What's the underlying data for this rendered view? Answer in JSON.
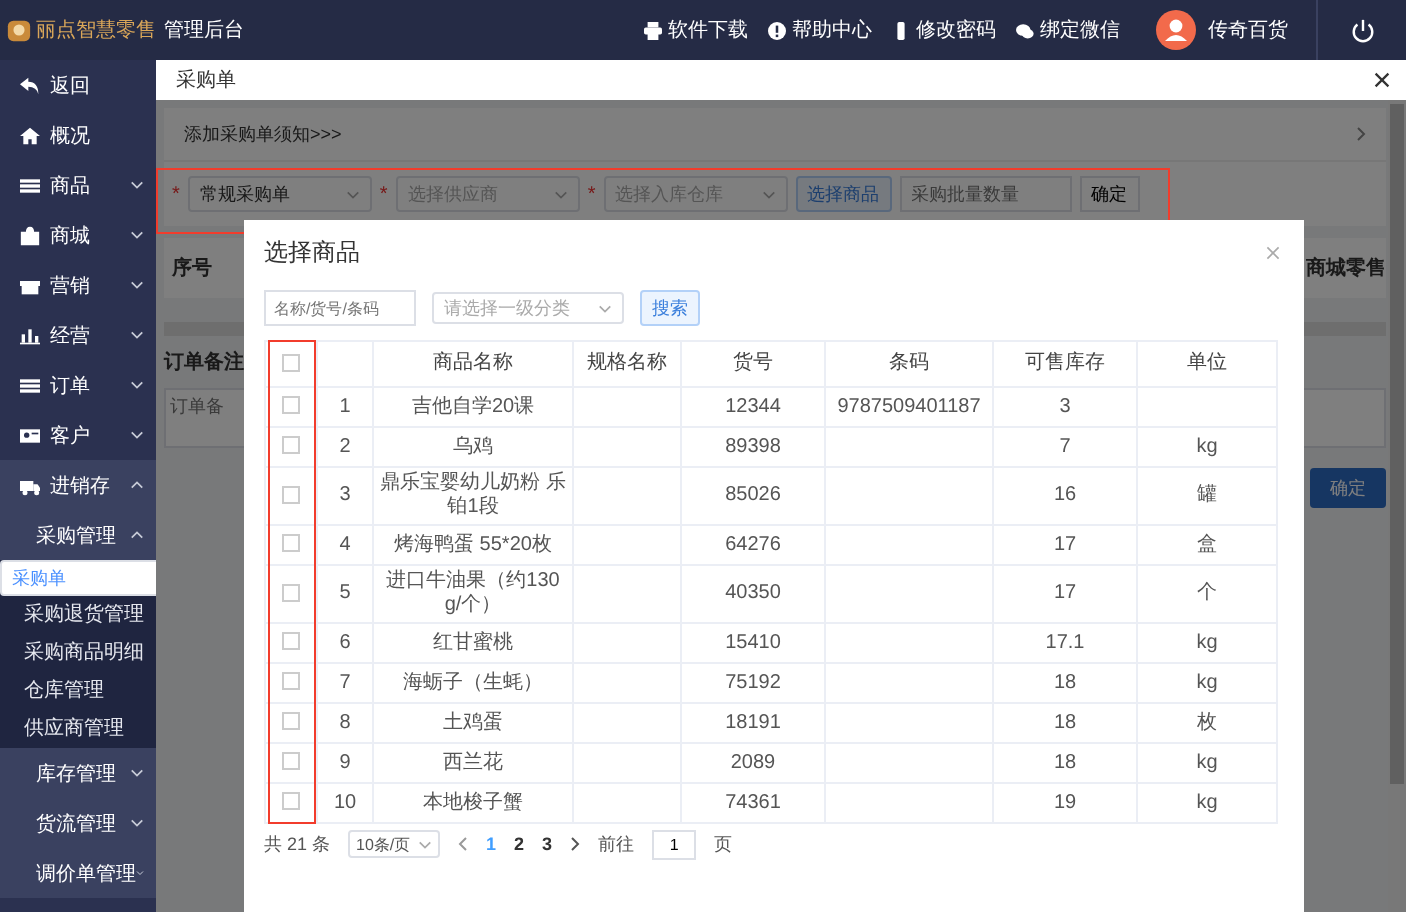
{
  "header": {
    "logo_text": "丽点智慧零售",
    "app_title": "管理后台",
    "links": [
      {
        "label": "软件下载"
      },
      {
        "label": "帮助中心"
      },
      {
        "label": "修改密码"
      },
      {
        "label": "绑定微信"
      }
    ],
    "user_name": "传奇百货"
  },
  "sidebar": {
    "items": [
      {
        "label": "返回",
        "kind": "link"
      },
      {
        "label": "概况",
        "kind": "link"
      },
      {
        "label": "商品",
        "kind": "group",
        "expanded": false
      },
      {
        "label": "商城",
        "kind": "group",
        "expanded": false
      },
      {
        "label": "营销",
        "kind": "group",
        "expanded": false
      },
      {
        "label": "经营",
        "kind": "group",
        "expanded": false
      },
      {
        "label": "订单",
        "kind": "group",
        "expanded": false
      },
      {
        "label": "客户",
        "kind": "group",
        "expanded": false
      },
      {
        "label": "进销存",
        "kind": "group",
        "expanded": true,
        "children": [
          {
            "label": "采购管理",
            "expanded": true,
            "children": [
              {
                "label": "采购单",
                "selected": true
              },
              {
                "label": "采购退货管理",
                "selected": false
              },
              {
                "label": "采购商品明细",
                "selected": false
              },
              {
                "label": "仓库管理",
                "selected": false
              },
              {
                "label": "供应商管理",
                "selected": false
              }
            ]
          },
          {
            "label": "库存管理",
            "expanded": false
          },
          {
            "label": "货流管理",
            "expanded": false
          },
          {
            "label": "调价单管理",
            "expanded": false
          }
        ]
      }
    ]
  },
  "tab": {
    "label": "采购单"
  },
  "page": {
    "required_marks": [
      "*",
      "*",
      "*"
    ],
    "notice": "添加采购单须知>>>",
    "order_type": "常规采购单",
    "supplier_placeholder": "选择供应商",
    "warehouse_placeholder": "选择入库仓库",
    "choose_button": "选择商品",
    "quantity_placeholder": "采购批量数量",
    "add_button": "确定",
    "table_columns": [
      "序号",
      "商城零售"
    ],
    "remark_label": "订单备注",
    "remark_placeholder": "订单备",
    "confirm_button": "确定"
  },
  "dialog": {
    "title": "选择商品",
    "search_placeholder": "名称/货号/条码",
    "category_placeholder": "请选择一级分类",
    "search_button": "搜索",
    "all_checked": false,
    "columns": [
      "商品名称",
      "规格名称",
      "货号",
      "条码",
      "可售库存",
      "单位"
    ],
    "rows": [
      {
        "index": "1",
        "name": "吉他自学20课",
        "code": "12344",
        "barcode": "9787509401187",
        "stock": "3",
        "checked": false
      },
      {
        "index": "2",
        "name": "乌鸡",
        "code": "89398",
        "stock": "7",
        "unit": "kg",
        "checked": false
      },
      {
        "index": "3",
        "name": "鼎乐宝婴幼儿奶粉 乐铂1段",
        "code": "85026",
        "stock": "16",
        "unit": "罐",
        "checked": false
      },
      {
        "index": "4",
        "name": "烤海鸭蛋 55*20枚",
        "code": "64276",
        "stock": "17",
        "unit": "盒",
        "checked": false
      },
      {
        "index": "5",
        "name": "进口牛油果（约130g/个）",
        "code": "40350",
        "stock": "17",
        "unit": "个",
        "checked": false
      },
      {
        "index": "6",
        "name": "红甘蜜桃",
        "code": "15410",
        "stock": "17.1",
        "unit": "kg",
        "checked": false
      },
      {
        "index": "7",
        "name": "海蛎子（生蚝）",
        "code": "75192",
        "stock": "18",
        "unit": "kg",
        "checked": false
      },
      {
        "index": "8",
        "name": "土鸡蛋",
        "code": "18191",
        "stock": "18",
        "unit": "枚",
        "checked": false
      },
      {
        "index": "9",
        "name": "西兰花",
        "code": "2089",
        "stock": "18",
        "unit": "kg",
        "checked": false
      },
      {
        "index": "10",
        "name": "本地梭子蟹",
        "code": "74361",
        "stock": "19",
        "unit": "kg",
        "checked": false
      }
    ],
    "pagination": {
      "total": "共 21 条",
      "page_size": "10条/页",
      "pages": [
        {
          "label": "1",
          "selected": true
        },
        {
          "label": "2",
          "selected": false
        },
        {
          "label": "3",
          "selected": false
        }
      ],
      "goto_label": "前往",
      "goto_value": "1",
      "page_suffix": "页"
    }
  }
}
